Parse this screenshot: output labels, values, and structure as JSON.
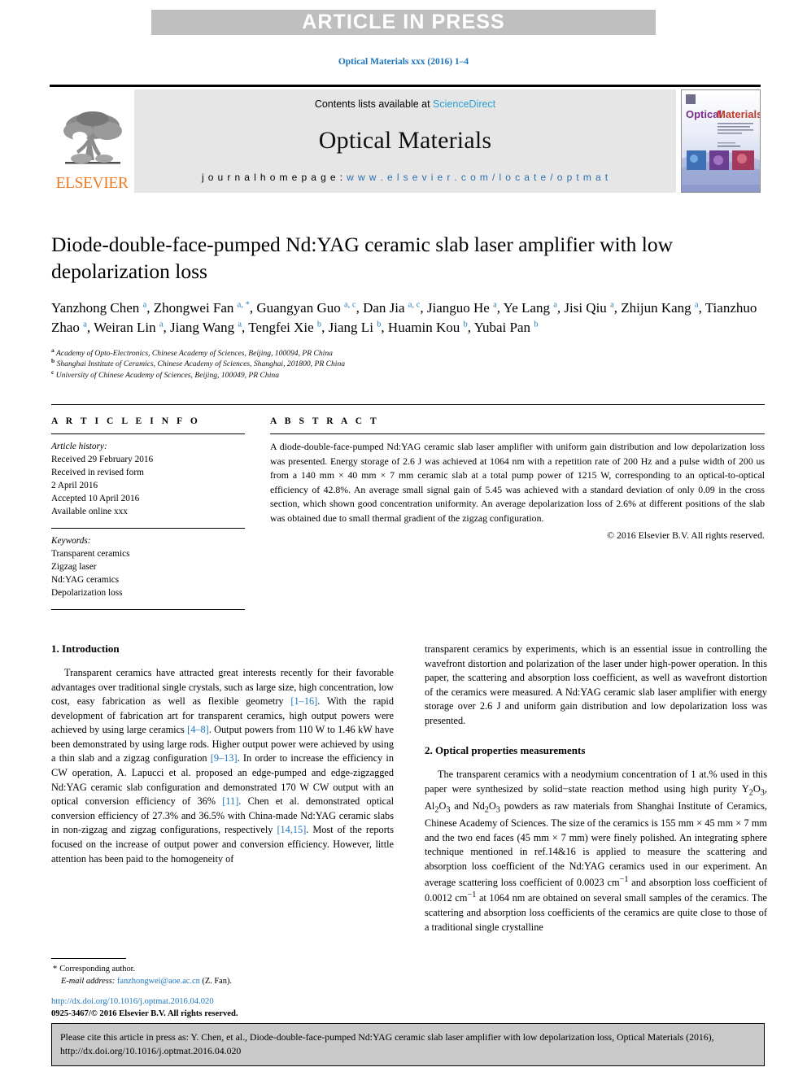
{
  "banner": {
    "label": "ARTICLE IN PRESS"
  },
  "running_head": "Optical Materials xxx (2016) 1–4",
  "masthead": {
    "contents_prefix": "Contents lists available at ",
    "sciencedirect": "ScienceDirect",
    "journal_title": "Optical Materials",
    "homepage_label": "j o u r n a l  h o m e p a g e :  ",
    "homepage_url": "w w w . e l s e v i e r . c o m / l o c a t e / o p t m a t",
    "publisher_wordmark": "ELSEVIER",
    "tree_icon": "elsevier-tree-icon",
    "cover_title_left": "Optical",
    "cover_title_right": "Materials",
    "colors": {
      "banner_bg": "#bfbfbf",
      "masthead_bg": "#e6e6e6",
      "elsevier_orange": "#ee7b23",
      "link_blue": "#1c75bc",
      "sciencedirect_blue": "#2a9fd6"
    }
  },
  "article": {
    "title": "Diode-double-face-pumped Nd:YAG ceramic slab laser amplifier with low depolarization loss",
    "authors": [
      {
        "name": "Yanzhong Chen",
        "marks": "a"
      },
      {
        "name": "Zhongwei Fan",
        "marks": "a, *"
      },
      {
        "name": "Guangyan Guo",
        "marks": "a, c"
      },
      {
        "name": "Dan Jia",
        "marks": "a, c"
      },
      {
        "name": "Jianguo He",
        "marks": "a"
      },
      {
        "name": "Ye Lang",
        "marks": "a"
      },
      {
        "name": "Jisi Qiu",
        "marks": "a"
      },
      {
        "name": "Zhijun Kang",
        "marks": "a"
      },
      {
        "name": "Tianzhuo Zhao",
        "marks": "a"
      },
      {
        "name": "Weiran Lin",
        "marks": "a"
      },
      {
        "name": "Jiang Wang",
        "marks": "a"
      },
      {
        "name": "Tengfei Xie",
        "marks": "b"
      },
      {
        "name": "Jiang Li",
        "marks": "b"
      },
      {
        "name": "Huamin Kou",
        "marks": "b"
      },
      {
        "name": "Yubai Pan",
        "marks": "b"
      }
    ],
    "affiliations": [
      {
        "mark": "a",
        "text": "Academy of Opto-Electronics, Chinese Academy of Sciences, Beijing, 100094, PR China"
      },
      {
        "mark": "b",
        "text": "Shanghai Institute of Ceramics, Chinese Academy of Sciences, Shanghai, 201800, PR China"
      },
      {
        "mark": "c",
        "text": "University of Chinese Academy of Sciences, Beijing, 100049, PR China"
      }
    ]
  },
  "article_info": {
    "heading": "A R T I C L E  I N F O",
    "history_label": "Article history:",
    "history": [
      "Received 29 February 2016",
      "Received in revised form",
      "2 April 2016",
      "Accepted 10 April 2016",
      "Available online xxx"
    ],
    "keywords_label": "Keywords:",
    "keywords": [
      "Transparent ceramics",
      "Zigzag laser",
      "Nd:YAG ceramics",
      "Depolarization loss"
    ]
  },
  "abstract": {
    "heading": "A B S T R A C T",
    "text": "A diode-double-face-pumped Nd:YAG ceramic slab laser amplifier with uniform gain distribution and low depolarization loss was presented. Energy storage of 2.6 J was achieved at 1064 nm with a repetition rate of 200 Hz and a pulse width of 200 us from a 140 mm × 40 mm × 7 mm ceramic slab at a total pump power of 1215 W, corresponding to an optical-to-optical efficiency of 42.8%. An average small signal gain of 5.45 was achieved with a standard deviation of only 0.09 in the cross section, which shown good concentration uniformity. An average depolarization loss of 2.6% at different positions of the slab was obtained due to small thermal gradient of the zigzag configuration.",
    "copyright": "© 2016 Elsevier B.V. All rights reserved."
  },
  "sections": {
    "intro_heading": "1. Introduction",
    "intro_p1_a": "Transparent ceramics have attracted great interests recently for their favorable advantages over traditional single crystals, such as large size, high concentration, low cost, easy fabrication as well as flexible geometry ",
    "ref_1_16": "[1–16]",
    "intro_p1_b": ". With the rapid development of fabrication art for transparent ceramics, high output powers were achieved by using large ceramics ",
    "ref_4_8": "[4–8]",
    "intro_p1_c": ". Output powers from 110 W to 1.46 kW have been demonstrated by using large rods. Higher output power were achieved by using a thin slab and a zigzag configuration ",
    "ref_9_13": "[9–13]",
    "intro_p1_d": ". In order to increase the efficiency in CW operation, A. Lapucci et al. proposed an edge-pumped and edge-zigzagged Nd:YAG ceramic slab configuration and demonstrated 170 W CW output with an optical conversion efficiency of 36% ",
    "ref_11": "[11]",
    "intro_p1_e": ". Chen et al. demonstrated optical conversion efficiency of 27.3% and 36.5% with China-made Nd:YAG ceramic slabs in non-zigzag and zigzag configurations, respectively ",
    "ref_14_15": "[14,15]",
    "intro_p1_f": ". Most of the reports focused on the increase of output power and conversion efficiency. However, little attention has been paid to the homogeneity of",
    "intro_p1_cont": "transparent ceramics by experiments, which is an essential issue in controlling the wavefront distortion and polarization of the laser under high-power operation. In this paper, the scattering and absorption loss coefficient, as well as wavefront distortion of the ceramics were measured. A Nd:YAG ceramic slab laser amplifier with energy storage over 2.6 J and uniform gain distribution and low depolarization loss was presented.",
    "optical_heading": "2. Optical properties measurements",
    "optical_p1_a": "The transparent ceramics with a neodymium concentration of 1 at.% used in this paper were synthesized by solid−state reaction method using high purity Y",
    "sub_2a": "2",
    "optical_p1_b": "O",
    "sub_3a": "3",
    "optical_p1_c": ", Al",
    "sub_2b": "2",
    "optical_p1_d": "O",
    "sub_3b": "3",
    "optical_p1_e": " and Nd",
    "sub_2c": "2",
    "optical_p1_f": "O",
    "sub_3c": "3",
    "optical_p1_g": " powders as raw materials from Shanghai Institute of Ceramics, Chinese Academy of Sciences. The size of the ceramics is 155 mm × 45 mm × 7 mm and the two end faces (45 mm × 7 mm) were finely polished. An integrating sphere technique mentioned in ref.14&16 is applied to measure the scattering and absorption loss coefficient of the Nd:YAG ceramics used in our experiment. An average scattering loss coefficient of 0.0023 cm",
    "sup_m1a": "−1",
    "optical_p1_h": " and absorption loss coefficient of 0.0012 cm",
    "sup_m1b": "−1",
    "optical_p1_i": " at 1064 nm are obtained on several small samples of the ceramics. The scattering and absorption loss coefficients of the ceramics are quite close to those of a traditional single crystalline"
  },
  "footnote": {
    "star": "*",
    "corresponding": "Corresponding author.",
    "email_label": "E-mail address:",
    "email": "fanzhongwei@aoe.ac.cn",
    "email_suffix": "(Z. Fan)."
  },
  "doi_block": {
    "doi_url": "http://dx.doi.org/10.1016/j.optmat.2016.04.020",
    "issn_line": "0925-3467/© 2016 Elsevier B.V. All rights reserved."
  },
  "citation_footer": {
    "text": "Please cite this article in press as: Y. Chen, et al., Diode-double-face-pumped Nd:YAG ceramic slab laser amplifier with low depolarization loss, Optical Materials (2016), http://dx.doi.org/10.1016/j.optmat.2016.04.020"
  }
}
